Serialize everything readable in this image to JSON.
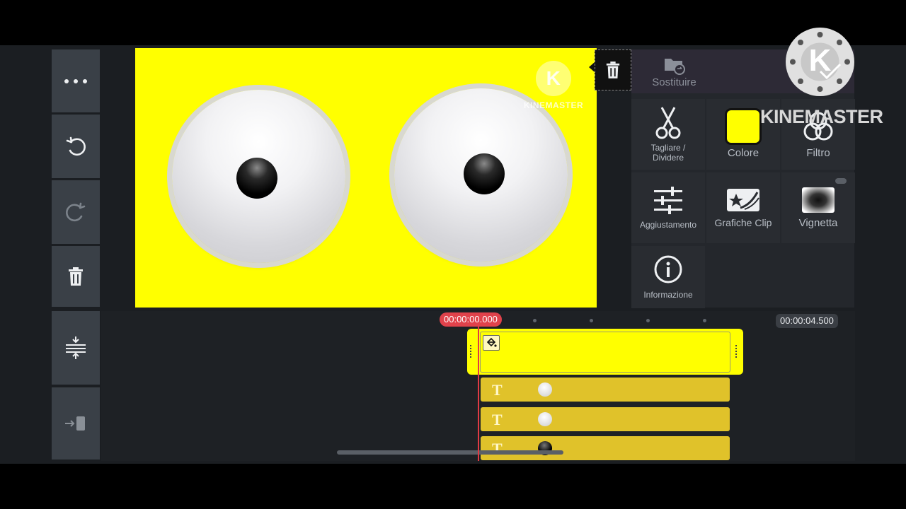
{
  "left_toolbar": {
    "more_icon": "ellipsis-icon",
    "undo_icon": "undo-icon",
    "redo_icon": "redo-icon",
    "delete_icon": "trash-icon",
    "expand_icon": "expand-tracks-icon",
    "export_icon": "export-icon"
  },
  "preview": {
    "background_color": "#ffff00",
    "watermark_letter": "K",
    "watermark_text": "KINEMASTER"
  },
  "panel": {
    "replace_label": "Sostituire",
    "tools": [
      {
        "label": "Tagliare /\nDividere",
        "icon": "scissors-icon"
      },
      {
        "label": "Colore",
        "icon": "color-swatch-icon"
      },
      {
        "label": "Filtro",
        "icon": "filter-icon"
      },
      {
        "label": "Aggiustamento",
        "icon": "sliders-icon"
      },
      {
        "label": "Grafiche Clip",
        "icon": "clip-graphics-icon"
      },
      {
        "label": "Vignetta",
        "icon": "vignette-icon"
      },
      {
        "label": "Informazione",
        "icon": "info-icon"
      }
    ],
    "swatch_color": "#ffff00"
  },
  "overlay_logo": {
    "letter": "K",
    "text": "KINEMASTER"
  },
  "timeline": {
    "current_time": "00:00:00.000",
    "total_time": "00:00:04.500",
    "main_clip_color": "#ffff00",
    "layers": [
      {
        "label": "T",
        "thumb": "white"
      },
      {
        "label": "T",
        "thumb": "white"
      },
      {
        "label": "T",
        "thumb": "black"
      }
    ]
  }
}
